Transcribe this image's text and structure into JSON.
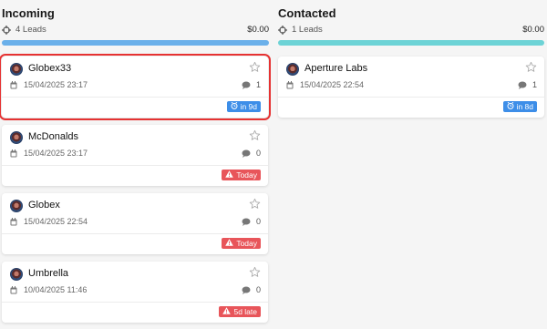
{
  "columns": [
    {
      "title": "Incoming",
      "leads": "4 Leads",
      "amount": "$0.00",
      "bar_color": "#6ab0ea",
      "cards": [
        {
          "name": "Globex33",
          "date": "15/04/2025 23:17",
          "comments": "1",
          "badge": "in 9d",
          "badge_color": "blue",
          "badge_icon": "alarm-clock-icon",
          "selected": true
        },
        {
          "name": "McDonalds",
          "date": "15/04/2025 23:17",
          "comments": "0",
          "badge": "Today",
          "badge_color": "red",
          "badge_icon": "warning-icon"
        },
        {
          "name": "Globex",
          "date": "15/04/2025 22:54",
          "comments": "0",
          "badge": "Today",
          "badge_color": "red",
          "badge_icon": "warning-icon"
        },
        {
          "name": "Umbrella",
          "date": "10/04/2025 11:46",
          "comments": "0",
          "badge": "5d late",
          "badge_color": "red",
          "badge_icon": "warning-icon"
        }
      ]
    },
    {
      "title": "Contacted",
      "leads": "1 Leads",
      "amount": "$0.00",
      "bar_color": "#6dd3d6",
      "cards": [
        {
          "name": "Aperture Labs",
          "date": "15/04/2025 22:54",
          "comments": "1",
          "badge": "in 8d",
          "badge_color": "blue",
          "badge_icon": "alarm-clock-icon"
        }
      ]
    }
  ]
}
